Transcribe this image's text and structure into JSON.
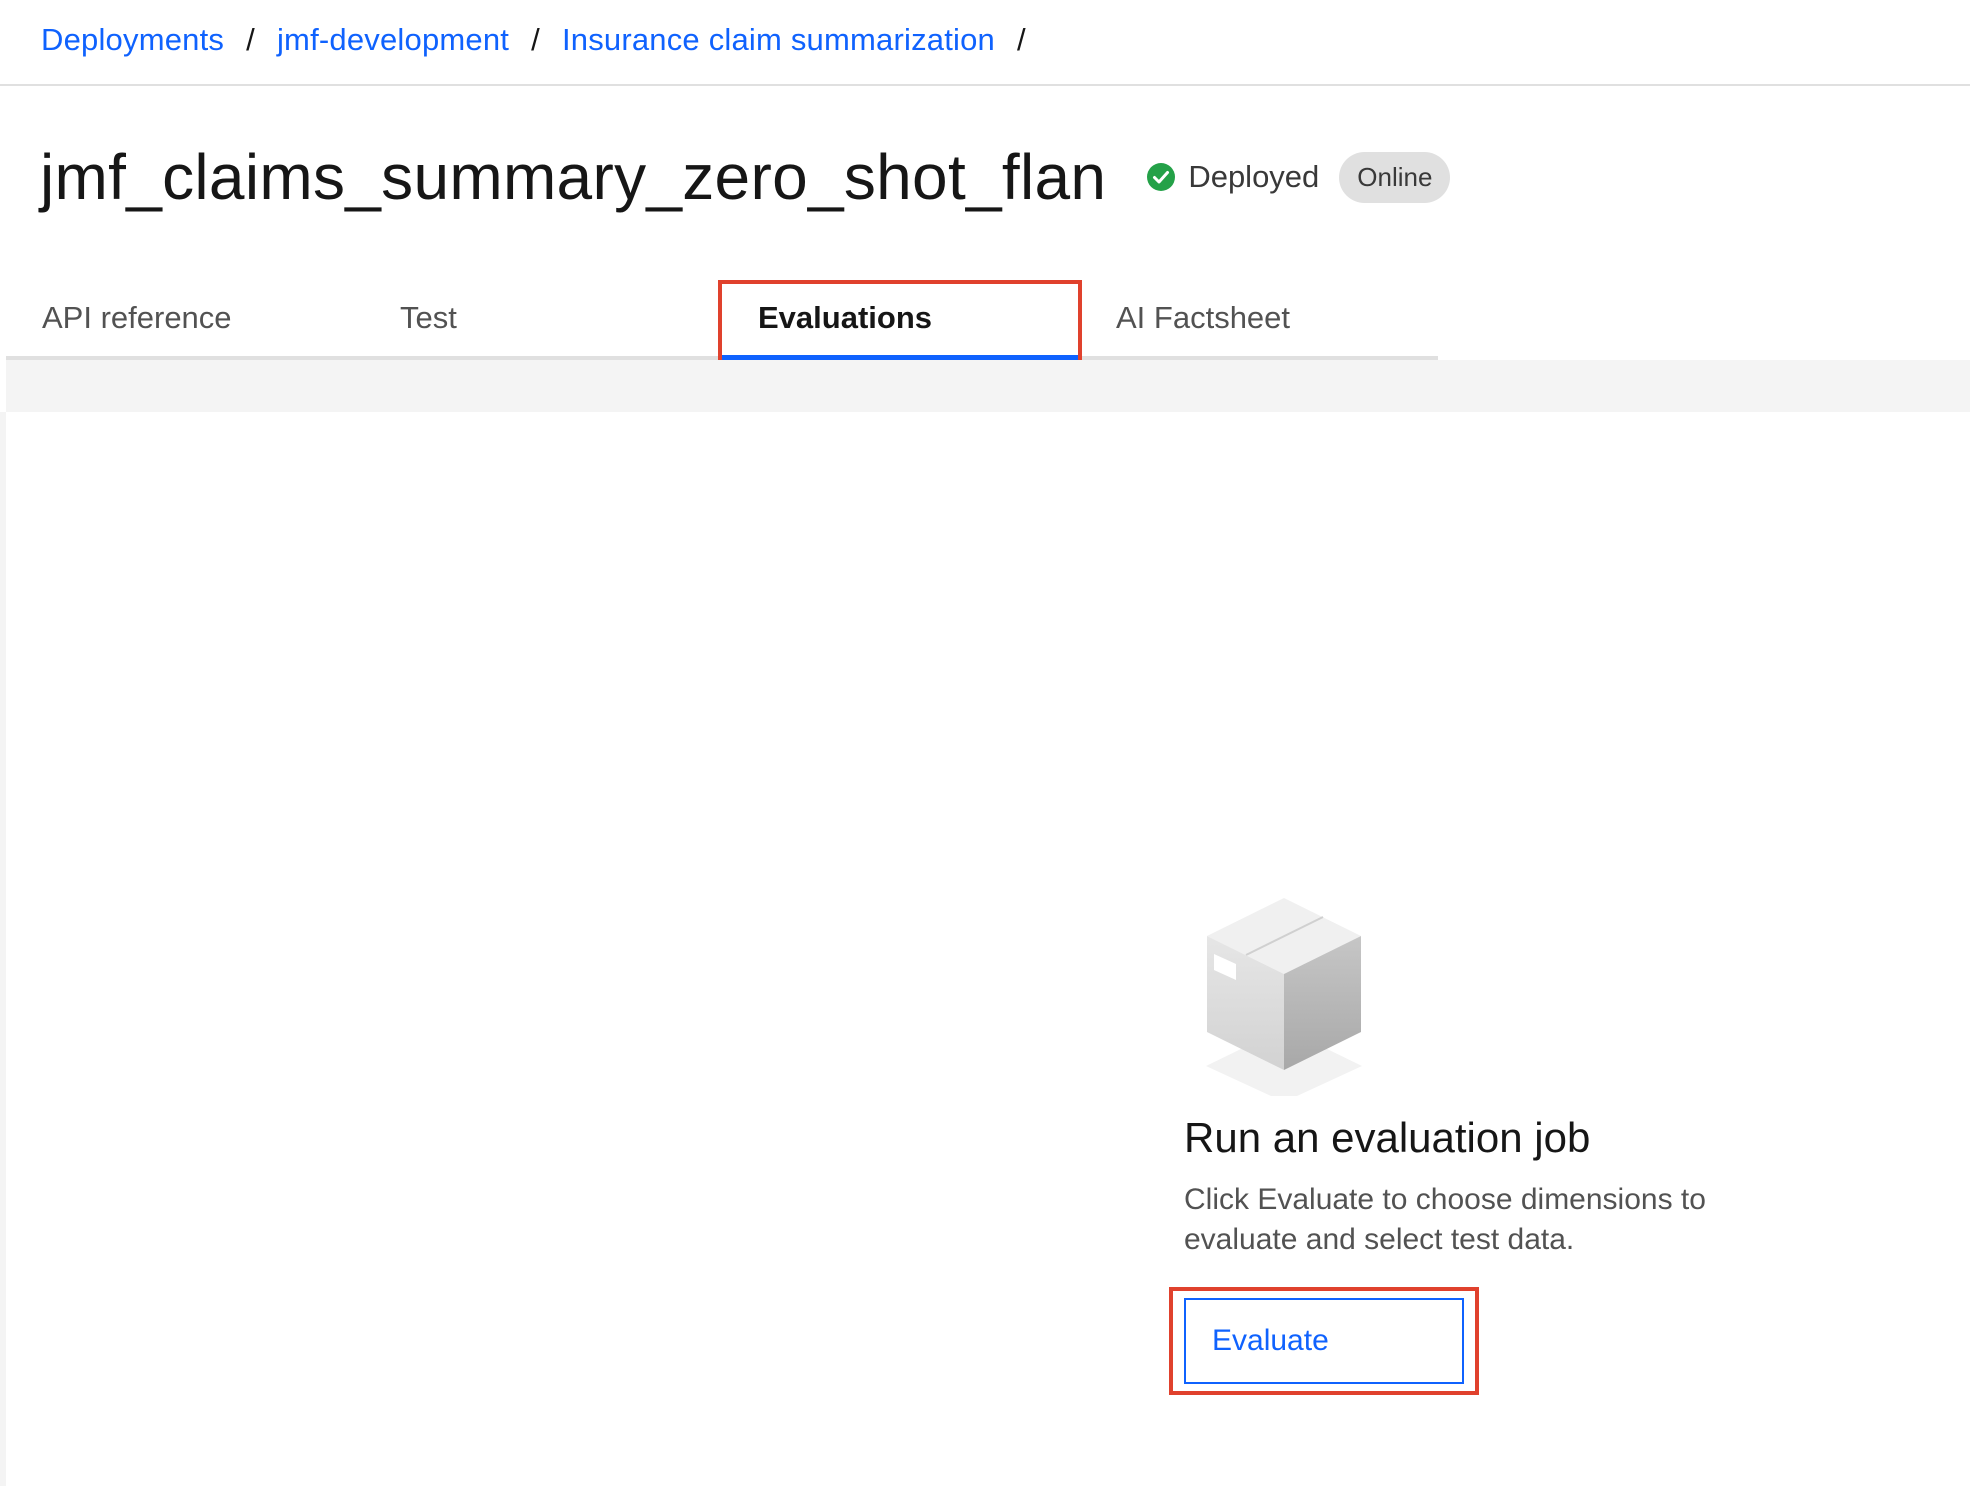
{
  "breadcrumb": {
    "items": [
      "Deployments",
      "jmf-development",
      "Insurance claim summarization"
    ],
    "separator": "/"
  },
  "page": {
    "title": "jmf_claims_summary_zero_shot_flan",
    "status_text": "Deployed",
    "status_icon": "checkmark-circle-icon",
    "status_color": "#24a148",
    "badge": "Online"
  },
  "tabs": [
    {
      "label": "API reference",
      "active": false
    },
    {
      "label": "Test",
      "active": false
    },
    {
      "label": "Evaluations",
      "active": true
    },
    {
      "label": "AI Factsheet",
      "active": false
    }
  ],
  "empty_state": {
    "illustration": "box-icon",
    "title": "Run an evaluation job",
    "description": "Click Evaluate to choose dimensions to evaluate and select test data.",
    "button_label": "Evaluate"
  },
  "colors": {
    "link": "#0f62fe",
    "highlight": "#e0412d"
  }
}
